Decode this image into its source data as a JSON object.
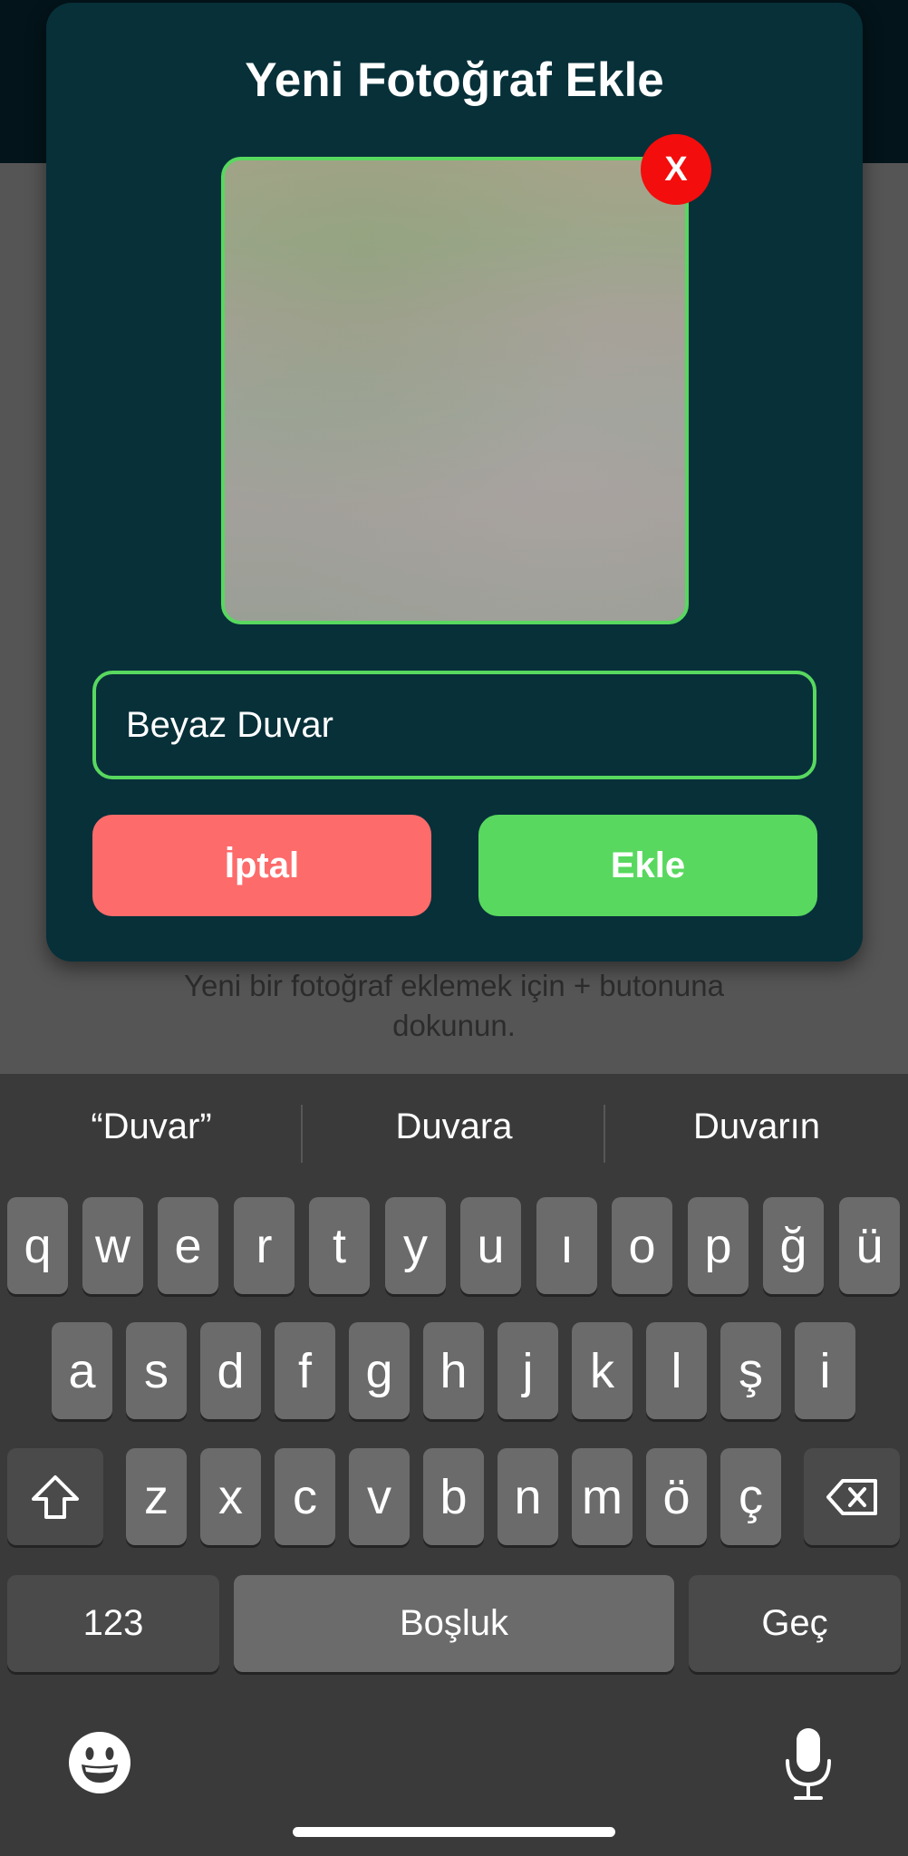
{
  "modal": {
    "title": "Yeni Fotoğraf Ekle",
    "remove_label": "X",
    "input_value": "Beyaz Duvar",
    "cancel_label": "İptal",
    "add_label": "Ekle"
  },
  "background": {
    "hint": "Yeni bir fotoğraf eklemek için + butonuna dokunun."
  },
  "keyboard": {
    "suggestions": [
      "“Duvar”",
      "Duvara",
      "Duvarın"
    ],
    "row1": [
      "q",
      "w",
      "e",
      "r",
      "t",
      "y",
      "u",
      "ı",
      "o",
      "p",
      "ğ",
      "ü"
    ],
    "row2": [
      "a",
      "s",
      "d",
      "f",
      "g",
      "h",
      "j",
      "k",
      "l",
      "ş",
      "i"
    ],
    "row3": [
      "z",
      "x",
      "c",
      "v",
      "b",
      "n",
      "m",
      "ö",
      "ç"
    ],
    "numbers_label": "123",
    "space_label": "Boşluk",
    "return_label": "Geç"
  },
  "colors": {
    "modal_bg": "#073039",
    "accent_green": "#58d85f",
    "cancel_red": "#fd6b6b",
    "remove_red": "#f30d0d"
  }
}
